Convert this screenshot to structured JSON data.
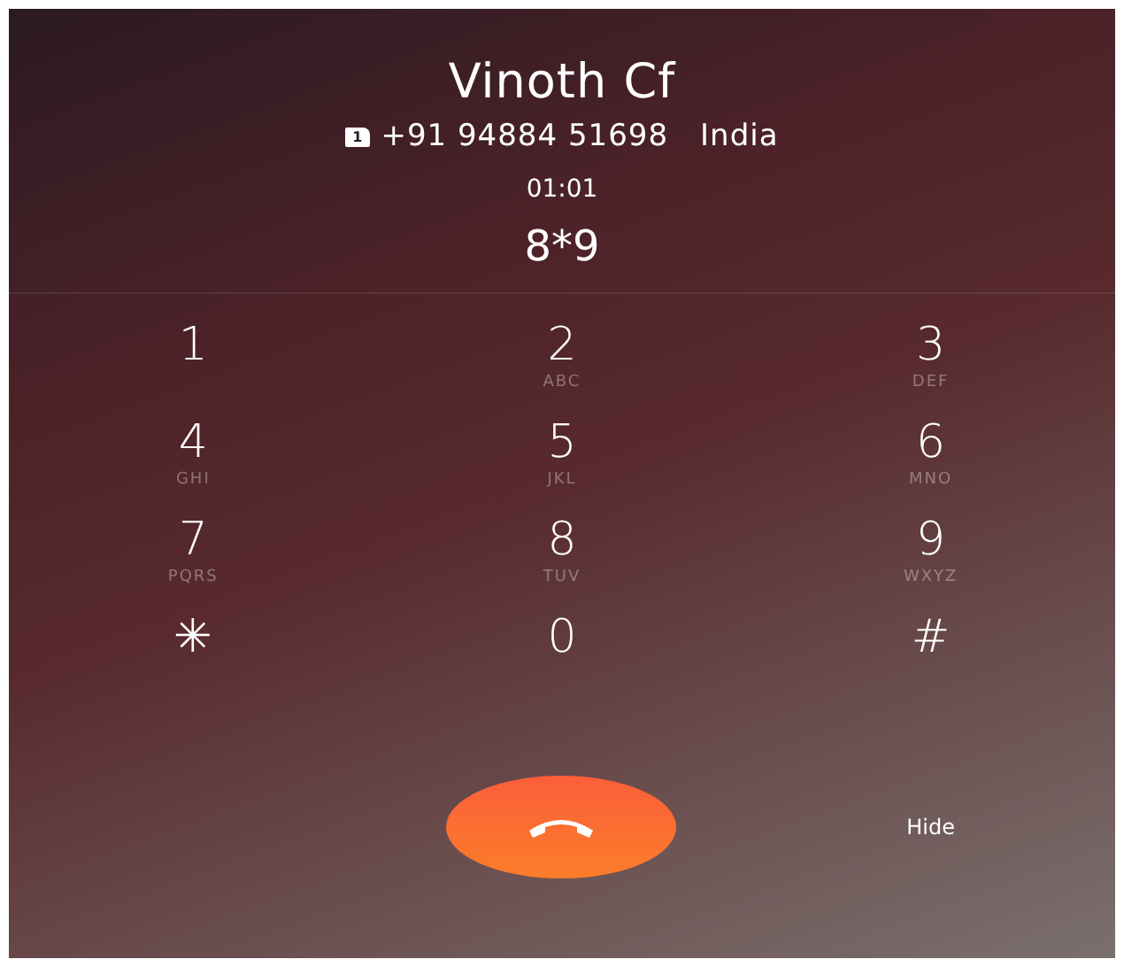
{
  "caller": {
    "name": "Vinoth Cf",
    "sim_slot": "1",
    "number": "+91 94884 51698",
    "location": "India",
    "duration": "01:01",
    "dialed": "8*9"
  },
  "keypad": [
    {
      "digit": "1"
    },
    {
      "digit": "2",
      "letters": "ABC"
    },
    {
      "digit": "3",
      "letters": "DEF"
    },
    {
      "digit": "4",
      "letters": "GHI"
    },
    {
      "digit": "5",
      "letters": "JKL"
    },
    {
      "digit": "6",
      "letters": "MNO"
    },
    {
      "digit": "7",
      "letters": "PQRS"
    },
    {
      "digit": "8",
      "letters": "TUV"
    },
    {
      "digit": "9",
      "letters": "WXYZ"
    },
    {
      "digit": "✳"
    },
    {
      "digit": "0"
    },
    {
      "digit": "#"
    }
  ],
  "hide_button": "Hide"
}
